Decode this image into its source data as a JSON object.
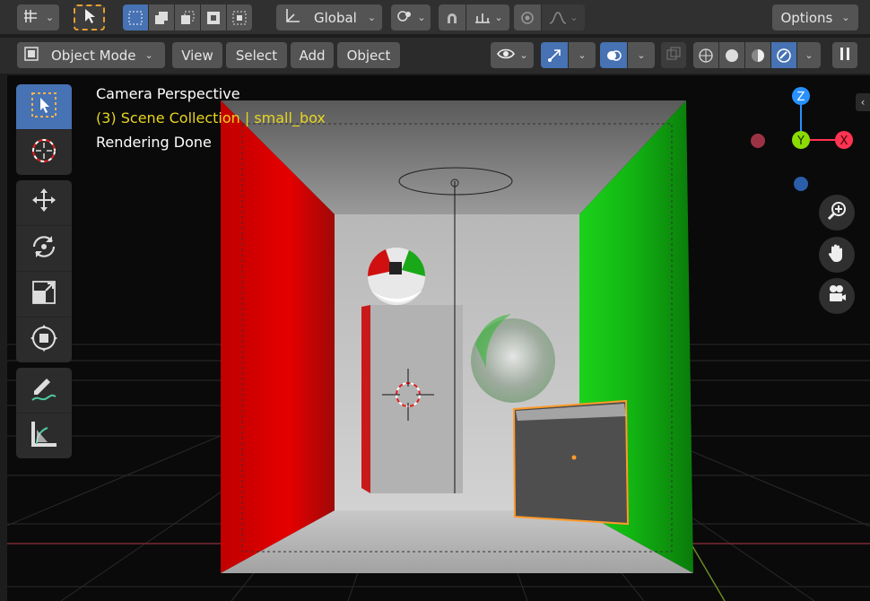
{
  "top_header": {
    "orientation_label": "Global",
    "options_label": "Options"
  },
  "view_header": {
    "mode_label": "Object Mode",
    "menus": [
      "View",
      "Select",
      "Add",
      "Object"
    ]
  },
  "overlay_info": {
    "view_name": "Camera Perspective",
    "collection_line": "(3) Scene Collection | small_box",
    "status_line": "Rendering Done"
  },
  "gizmo": {
    "z_label": "Z",
    "y_label": "Y",
    "x_label": "X"
  },
  "colors": {
    "accent": "#4772b3",
    "collection_text": "#e8d51e",
    "selected_outline": "#ff9a2a",
    "axis_x": "#ff3352",
    "axis_y": "#8bdc00",
    "axis_z": "#2890ff",
    "wall_left": "#e00000",
    "wall_right": "#10b010"
  }
}
